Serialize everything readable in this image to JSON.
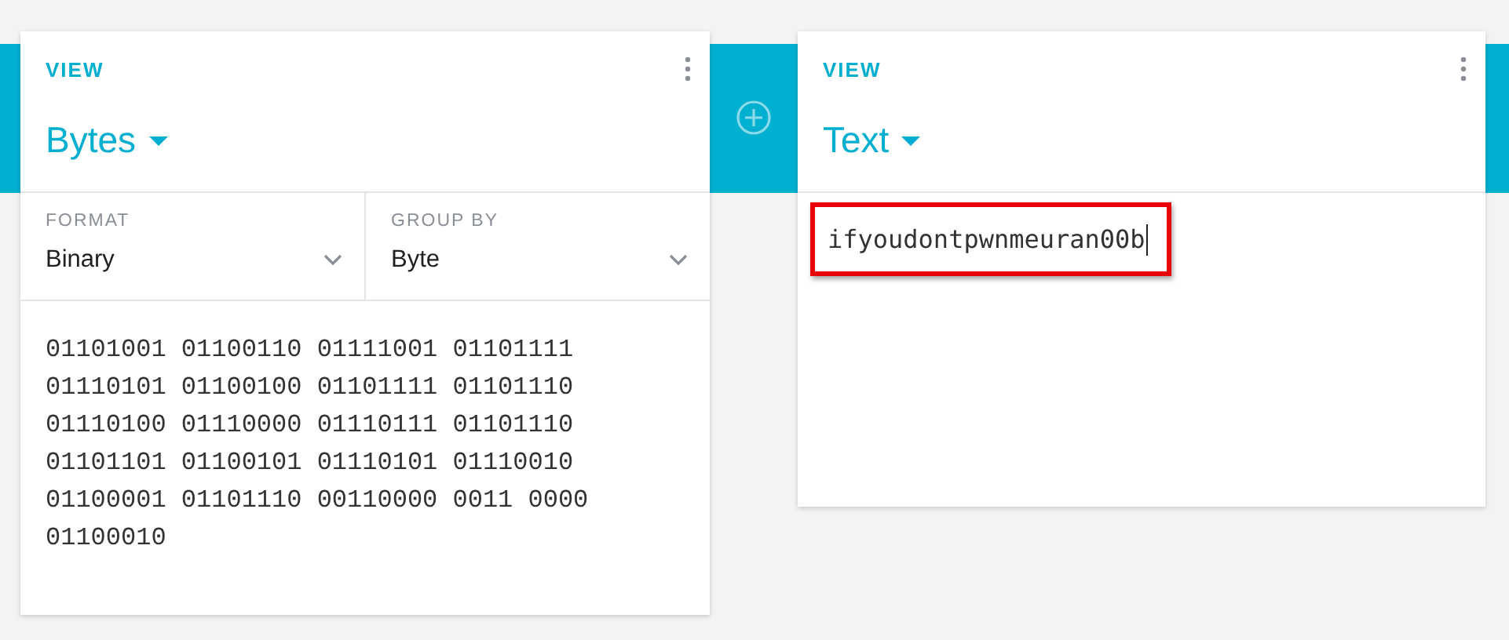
{
  "panels": [
    {
      "kind": "bytes",
      "label": "VIEW",
      "view": "Bytes",
      "options": [
        {
          "label": "FORMAT",
          "value": "Binary"
        },
        {
          "label": "GROUP BY",
          "value": "Byte"
        }
      ],
      "lines": [
        "01101001 01100110 01111001 01101111",
        "01110101 01100100 01101111 01101110",
        "01110100 01110000 01110111 01101110",
        "01101101 01100101 01110101 01110010",
        "01100001 01101110 00110000 0011 0000",
        "01100010"
      ]
    },
    {
      "kind": "text",
      "label": "VIEW",
      "view": "Text",
      "value": "ifyoudontpwnmeuran00b",
      "highlighted": true
    }
  ]
}
